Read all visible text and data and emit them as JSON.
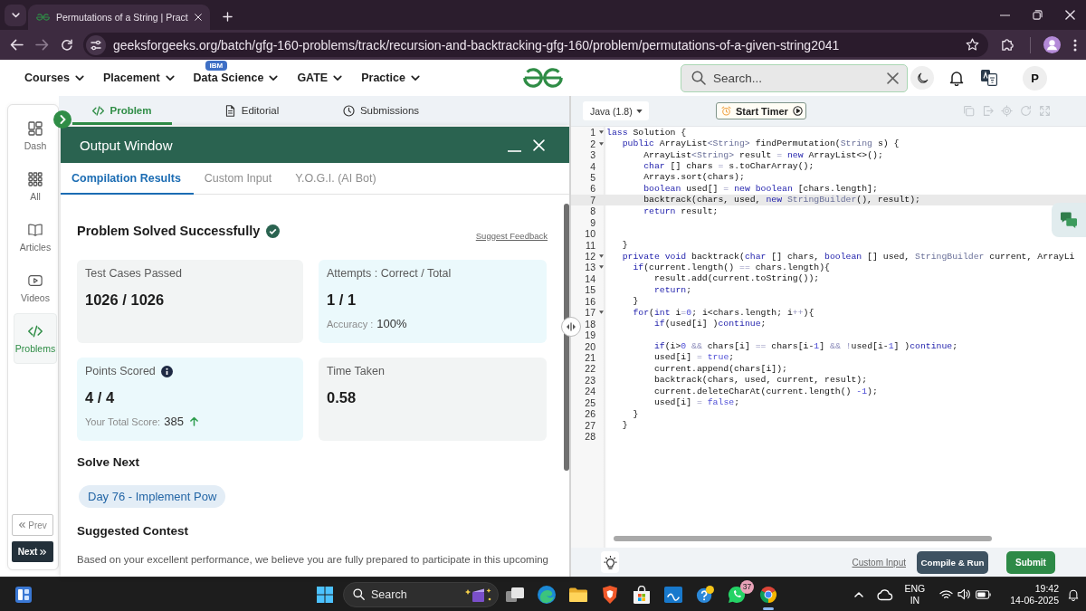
{
  "browser": {
    "tab": {
      "title": "Permutations of a String | Pract",
      "selected": true
    },
    "url": "geeksforgeeks.org/batch/gfg-160-problems/track/recursion-and-backtracking-gfg-160/problem/permutations-of-a-given-string2041"
  },
  "site_nav": {
    "menus": [
      {
        "label": "Courses"
      },
      {
        "label": "Placement"
      },
      {
        "label": "Data Science",
        "badge": "IBM"
      },
      {
        "label": "GATE"
      },
      {
        "label": "Practice"
      }
    ],
    "search": {
      "placeholder": "Search..."
    },
    "avatar": "P"
  },
  "sidebar": {
    "items": [
      {
        "kind": "dashboard",
        "label": "Dash",
        "selected": false
      },
      {
        "kind": "grid",
        "label": "All",
        "selected": false
      },
      {
        "kind": "book",
        "label": "Articles",
        "selected": false
      },
      {
        "kind": "video",
        "label": "Videos",
        "selected": false
      },
      {
        "kind": "code",
        "label": "Problems",
        "selected": true
      }
    ],
    "prev": "Prev",
    "next": "Next"
  },
  "problem_tabs": [
    {
      "kind": "code",
      "label": "Problem",
      "selected": true
    },
    {
      "kind": "document",
      "label": "Editorial",
      "selected": false
    },
    {
      "kind": "clock",
      "label": "Submissions",
      "selected": false
    }
  ],
  "output_window": {
    "title": "Output Window",
    "tabs": [
      {
        "label": "Compilation Results",
        "selected": true
      },
      {
        "label": "Custom Input",
        "selected": false
      },
      {
        "label": "Y.O.G.I. (AI Bot)",
        "selected": false
      }
    ],
    "status": "Problem Solved Successfully",
    "feedback_link": "Suggest Feedback",
    "cards": [
      {
        "label": "Test Cases Passed",
        "info": false,
        "value": "1026 / 1026"
      },
      {
        "label": "Attempts : Correct / Total",
        "info": false,
        "value": "1 / 1",
        "detail": {
          "label": "Accuracy :",
          "value": "100%",
          "rising": false
        }
      },
      {
        "label": "Points Scored",
        "info": true,
        "value": "4 / 4",
        "detail": {
          "label": "Your Total Score:",
          "value": "385",
          "rising": true
        }
      },
      {
        "label": "Time Taken",
        "info": false,
        "value": "0.58"
      }
    ],
    "solve_next": {
      "heading": "Solve Next",
      "link": "Day 76 - Implement Pow"
    },
    "suggested_contest": {
      "heading": "Suggested Contest",
      "text": "Based on your excellent performance, we believe you are fully prepared to participate in this upcoming"
    }
  },
  "editor": {
    "language": "Java (1.8)",
    "timer_button": "Start Timer",
    "lines": [
      {
        "number": "1",
        "fold": true,
        "current": false,
        "tokens": [
          {
            "kind": "keyword",
            "text": "lass"
          },
          {
            "kind": "plain",
            "text": " Solution {"
          }
        ]
      },
      {
        "number": "2",
        "fold": true,
        "current": false,
        "tokens": [
          {
            "kind": "keyword",
            "text": "   public"
          },
          {
            "kind": "plain",
            "text": " ArrayList"
          },
          {
            "kind": "type",
            "text": "<String>"
          },
          {
            "kind": "plain",
            "text": " findPermutation("
          },
          {
            "kind": "type",
            "text": "String"
          },
          {
            "kind": "plain",
            "text": " s) {"
          }
        ]
      },
      {
        "number": "3",
        "fold": false,
        "current": false,
        "tokens": [
          {
            "kind": "plain",
            "text": "       ArrayList"
          },
          {
            "kind": "type",
            "text": "<String>"
          },
          {
            "kind": "plain",
            "text": " result "
          },
          {
            "kind": "operator",
            "text": "="
          },
          {
            "kind": "keyword",
            "text": " new"
          },
          {
            "kind": "plain",
            "text": " ArrayList<>();"
          }
        ]
      },
      {
        "number": "4",
        "fold": false,
        "current": false,
        "tokens": [
          {
            "kind": "keyword",
            "text": "       char"
          },
          {
            "kind": "plain",
            "text": " [] chars "
          },
          {
            "kind": "operator",
            "text": "="
          },
          {
            "kind": "plain",
            "text": " s.toCharArray();"
          }
        ]
      },
      {
        "number": "5",
        "fold": false,
        "current": false,
        "tokens": [
          {
            "kind": "plain",
            "text": "       Arrays.sort(chars);"
          }
        ]
      },
      {
        "number": "6",
        "fold": false,
        "current": false,
        "tokens": [
          {
            "kind": "keyword",
            "text": "       boolean"
          },
          {
            "kind": "plain",
            "text": " used[] "
          },
          {
            "kind": "operator",
            "text": "="
          },
          {
            "kind": "keyword",
            "text": " new boolean"
          },
          {
            "kind": "plain",
            "text": " [chars.length];"
          }
        ]
      },
      {
        "number": "7",
        "fold": false,
        "current": true,
        "tokens": [
          {
            "kind": "plain",
            "text": "       backtrack(chars, used, "
          },
          {
            "kind": "keyword",
            "text": "new"
          },
          {
            "kind": "type",
            "text": " StringBuilder"
          },
          {
            "kind": "plain",
            "text": "(), result);"
          }
        ]
      },
      {
        "number": "8",
        "fold": false,
        "current": false,
        "tokens": [
          {
            "kind": "keyword",
            "text": "       return"
          },
          {
            "kind": "plain",
            "text": " result;"
          }
        ]
      },
      {
        "number": "9",
        "fold": false,
        "current": false
      },
      {
        "number": "10",
        "fold": false,
        "current": false
      },
      {
        "number": "11",
        "fold": false,
        "current": false,
        "tokens": [
          {
            "kind": "plain",
            "text": "   }"
          }
        ]
      },
      {
        "number": "12",
        "fold": true,
        "current": false,
        "tokens": [
          {
            "kind": "keyword",
            "text": "   private void"
          },
          {
            "kind": "plain",
            "text": " backtrack("
          },
          {
            "kind": "keyword",
            "text": "char"
          },
          {
            "kind": "plain",
            "text": " [] chars, "
          },
          {
            "kind": "keyword",
            "text": "boolean"
          },
          {
            "kind": "plain",
            "text": " [] used, "
          },
          {
            "kind": "type",
            "text": "StringBuilder"
          },
          {
            "kind": "plain",
            "text": " current, ArrayLi"
          }
        ]
      },
      {
        "number": "13",
        "fold": true,
        "current": false,
        "tokens": [
          {
            "kind": "keyword",
            "text": "     if"
          },
          {
            "kind": "plain",
            "text": "(current.length() "
          },
          {
            "kind": "operator",
            "text": "=="
          },
          {
            "kind": "plain",
            "text": " chars.length){"
          }
        ]
      },
      {
        "number": "14",
        "fold": false,
        "current": false,
        "tokens": [
          {
            "kind": "plain",
            "text": "         result.add(current.toString());"
          }
        ]
      },
      {
        "number": "15",
        "fold": false,
        "current": false,
        "tokens": [
          {
            "kind": "keyword",
            "text": "         return"
          },
          {
            "kind": "plain",
            "text": ";"
          }
        ]
      },
      {
        "number": "16",
        "fold": false,
        "current": false,
        "tokens": [
          {
            "kind": "plain",
            "text": "     }"
          }
        ]
      },
      {
        "number": "17",
        "fold": true,
        "current": false,
        "tokens": [
          {
            "kind": "keyword",
            "text": "     for"
          },
          {
            "kind": "plain",
            "text": "("
          },
          {
            "kind": "keyword",
            "text": "int"
          },
          {
            "kind": "plain",
            "text": " i"
          },
          {
            "kind": "operator",
            "text": "="
          },
          {
            "kind": "literal",
            "text": "0"
          },
          {
            "kind": "plain",
            "text": "; i<chars.length; i"
          },
          {
            "kind": "operator",
            "text": "++"
          },
          {
            "kind": "plain",
            "text": "){"
          }
        ]
      },
      {
        "number": "18",
        "fold": false,
        "current": false,
        "tokens": [
          {
            "kind": "keyword",
            "text": "         if"
          },
          {
            "kind": "plain",
            "text": "(used[i] )"
          },
          {
            "kind": "keyword",
            "text": "continue"
          },
          {
            "kind": "plain",
            "text": ";"
          }
        ]
      },
      {
        "number": "19",
        "fold": false,
        "current": false
      },
      {
        "number": "20",
        "fold": false,
        "current": false,
        "tokens": [
          {
            "kind": "keyword",
            "text": "         if"
          },
          {
            "kind": "plain",
            "text": "(i>"
          },
          {
            "kind": "literal",
            "text": "0"
          },
          {
            "kind": "operator",
            "text": " &&"
          },
          {
            "kind": "plain",
            "text": " chars[i] "
          },
          {
            "kind": "operator",
            "text": "=="
          },
          {
            "kind": "plain",
            "text": " chars[i-"
          },
          {
            "kind": "literal",
            "text": "1"
          },
          {
            "kind": "plain",
            "text": "] "
          },
          {
            "kind": "operator",
            "text": "&& !"
          },
          {
            "kind": "plain",
            "text": "used[i-"
          },
          {
            "kind": "literal",
            "text": "1"
          },
          {
            "kind": "plain",
            "text": "] )"
          },
          {
            "kind": "keyword",
            "text": "continue"
          },
          {
            "kind": "plain",
            "text": ";"
          }
        ]
      },
      {
        "number": "21",
        "fold": false,
        "current": false,
        "tokens": [
          {
            "kind": "plain",
            "text": "         used[i] "
          },
          {
            "kind": "operator",
            "text": "="
          },
          {
            "kind": "literal",
            "text": " true"
          },
          {
            "kind": "plain",
            "text": ";"
          }
        ]
      },
      {
        "number": "22",
        "fold": false,
        "current": false,
        "tokens": [
          {
            "kind": "plain",
            "text": "         current.append(chars[i]);"
          }
        ]
      },
      {
        "number": "23",
        "fold": false,
        "current": false,
        "tokens": [
          {
            "kind": "plain",
            "text": "         backtrack(chars, used, current, result);"
          }
        ]
      },
      {
        "number": "24",
        "fold": false,
        "current": false,
        "tokens": [
          {
            "kind": "plain",
            "text": "         current.deleteCharAt(current.length() "
          },
          {
            "kind": "literal",
            "text": "-1"
          },
          {
            "kind": "plain",
            "text": ");"
          }
        ]
      },
      {
        "number": "25",
        "fold": false,
        "current": false,
        "tokens": [
          {
            "kind": "plain",
            "text": "         used[i] "
          },
          {
            "kind": "operator",
            "text": "="
          },
          {
            "kind": "literal",
            "text": " false"
          },
          {
            "kind": "plain",
            "text": ";"
          }
        ]
      },
      {
        "number": "26",
        "fold": false,
        "current": false,
        "tokens": [
          {
            "kind": "plain",
            "text": "     }"
          }
        ]
      },
      {
        "number": "27",
        "fold": false,
        "current": false,
        "tokens": [
          {
            "kind": "plain",
            "text": "   }"
          }
        ]
      },
      {
        "number": "28",
        "fold": false,
        "current": false
      }
    ],
    "footer": {
      "custom_input": "Custom Input",
      "compile_button": "Compile & Run",
      "submit_button": "Submit"
    }
  },
  "taskbar": {
    "search": {
      "placeholder": "Search"
    },
    "apps": [
      {
        "kind": "task-view",
        "selected": false
      },
      {
        "kind": "swirl",
        "selected": false
      },
      {
        "kind": "folder",
        "selected": false
      },
      {
        "kind": "shield",
        "selected": false
      },
      {
        "kind": "bag",
        "selected": false
      },
      {
        "kind": "tile",
        "selected": false
      },
      {
        "kind": "help",
        "selected": false
      },
      {
        "kind": "chat",
        "selected": false,
        "badge": "37"
      },
      {
        "kind": "ring",
        "selected": true
      }
    ],
    "language": "ENG",
    "region": "IN",
    "time": "19:42",
    "date": "14-06-2025"
  }
}
